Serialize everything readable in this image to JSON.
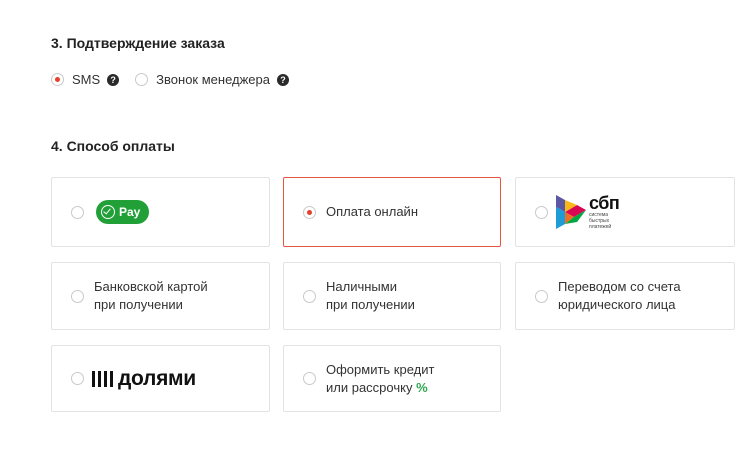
{
  "confirmation": {
    "title": "3. Подтверждение заказа",
    "options": [
      {
        "label": "SMS",
        "selected": true,
        "help": "?"
      },
      {
        "label": "Звонок менеджера",
        "selected": false,
        "help": "?"
      }
    ]
  },
  "payment": {
    "title": "4. Способ оплаты",
    "gpay_label": "Pay",
    "online_label": "Оплата онлайн",
    "sbp_word": "сбп",
    "sbp_sub": "система быстрых платежей",
    "card_line1": "Банковской картой",
    "card_line2": "при получении",
    "cash_line1": "Наличными",
    "cash_line2": "при получении",
    "transfer_line1": "Переводом со счета",
    "transfer_line2": "юридического лица",
    "dolyami_word": "долями",
    "credit_line1": "Оформить кредит",
    "credit_line2": "или рассрочку",
    "credit_pct": "%",
    "selected": "online"
  },
  "colors": {
    "accent": "#e5412d",
    "gpay": "#21a038",
    "percent": "#2fa84f"
  }
}
